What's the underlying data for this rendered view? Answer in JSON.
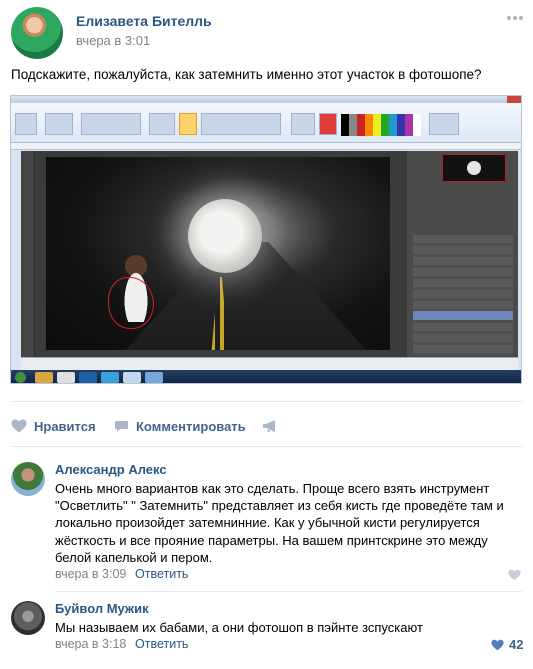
{
  "post": {
    "author": "Елизавета Бителль",
    "time": "вчера в 3:01",
    "text": "Подскажите, пожалуйста, как затемнить именно этот участок в фотошопе?",
    "menu_icon": "more-dots-icon"
  },
  "actions": {
    "like_label": "Нравится",
    "comment_label": "Комментировать",
    "share_icon": "megaphone-icon"
  },
  "comments": [
    {
      "author": "Александр Алекс",
      "text": "Очень много вариантов как это сделать. Проще всего взять инструмент \"Осветлить\" \" Затемнить\" представляет из себя кисть где проведёте там и локально произойдет затемнинние. Как у убычной кисти регулируется жёсткость и все прояние параметры. На вашем принтскрине это между белой капелькой и пером.",
      "time": "вчера в 3:09",
      "reply": "Ответить",
      "likes": ""
    },
    {
      "author": "Буйвол Мужик",
      "text": "Мы называем их бабами, а они фотошоп в пэйнте зспускают",
      "time": "вчера в 3:18",
      "reply": "Ответить",
      "likes": "42"
    }
  ],
  "colors": {
    "link": "#2a5885",
    "action": "#42648b",
    "muted": "#828282",
    "heart_active": "#5181b8",
    "heart_idle": "#c5d0db"
  }
}
